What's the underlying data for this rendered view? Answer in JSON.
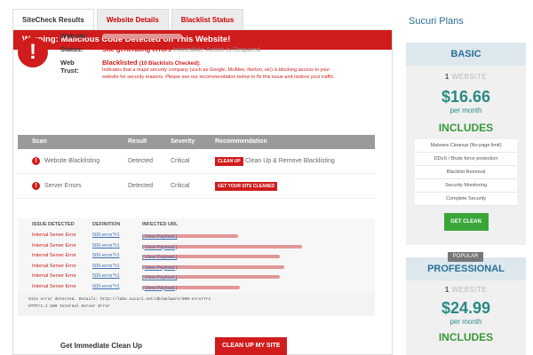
{
  "tabs": [
    {
      "label": "SiteCheck Results"
    },
    {
      "label": "Website Details"
    },
    {
      "label": "Blacklist Status"
    }
  ],
  "warning": {
    "title": "Warning: Malicious Code Detected on This Website!"
  },
  "status_block": {
    "website_label": "Website:",
    "status_label": "Status:",
    "status_value": "Site generating errors",
    "status_suffix": "Immediate Action is Required.",
    "trust_label_1": "Web",
    "trust_label_2": "Trust:",
    "trust_value": "Blacklisted",
    "trust_count": "(10 Blacklists Checked):",
    "trust_desc": "Indicates that a major security company (such as Google, McAfee, Norton, etc) is blocking access to your website for security reasons. Please see our recommendation below to fix this issue and restore your traffic."
  },
  "scan_table": {
    "headers": [
      "Scan",
      "Result",
      "Severity",
      "Recommendation"
    ],
    "rows": [
      {
        "scan": "Website Blacklisting",
        "result": "Detected",
        "severity": "Critical",
        "pill": "CLEAN UP",
        "recommendation": "Clean Up & Remove Blacklisting"
      },
      {
        "scan": "Server Errors",
        "result": "Detected",
        "severity": "Critical",
        "pill": "GET YOUR SITE CLEANED",
        "recommendation": ""
      }
    ]
  },
  "issues": {
    "headers": [
      "ISSUE DETECTED",
      "DEFINITION",
      "INFECTED URL"
    ],
    "rows": [
      {
        "issue": "Internal Server Error",
        "definition": "500-error?r1",
        "link": "[ View Payload ]"
      },
      {
        "issue": "Internal Server Error",
        "definition": "500-error?r1",
        "link": "[ View Payload ]"
      },
      {
        "issue": "Internal Server Error",
        "definition": "500-error?r1",
        "link": "[ View Payload ]"
      },
      {
        "issue": "Internal Server Error",
        "definition": "500-error?r1",
        "link": "[ View Payload ]"
      },
      {
        "issue": "Internal Server Error",
        "definition": "500-error?r1",
        "link": "[ View Payload ]"
      },
      {
        "issue": "Internal Server Error",
        "definition": "500-error?r1",
        "link": "[ View Payload ]"
      }
    ]
  },
  "detail": {
    "line1": "Site error detected. Details: http://labs.sucuri.net/db/malware/500-error?r1",
    "line2": "HTTP/1.1 500 Internal Server Error"
  },
  "cta": {
    "text": "Get Immediate Clean Up",
    "button": "CLEAN UP MY SITE"
  },
  "plans": {
    "title": "Sucuri Plans",
    "basic": {
      "name": "BASIC",
      "count": "1",
      "count_label": "WEBSITE",
      "price": "$16.66",
      "per": "per month",
      "includes": "INCLUDES",
      "features": [
        "Malware Cleanup (No page limit)",
        "DDoS / Brute force protection",
        "Blacklist Removal",
        "Security Monitoring",
        "Complete Security"
      ],
      "button": "GET CLEAN"
    },
    "professional": {
      "badge": "POPULAR",
      "name": "PROFESSIONAL",
      "count": "1",
      "count_label": "WEBSITE",
      "price": "$24.99",
      "per": "per month",
      "includes": "INCLUDES"
    }
  },
  "colors": {
    "accent_red": "#d01c1c",
    "plan_blue": "#2a6f98",
    "price_teal": "#2a8a84",
    "green": "#3aa63a"
  }
}
